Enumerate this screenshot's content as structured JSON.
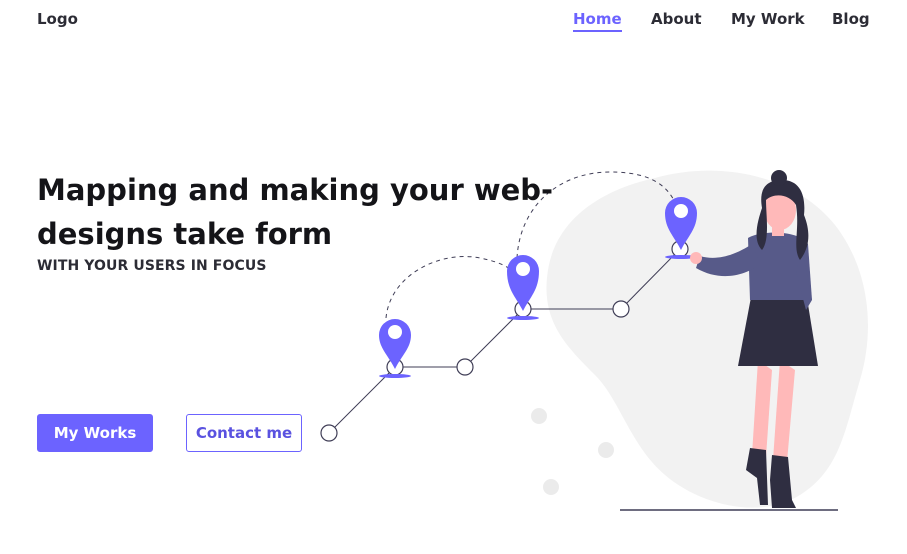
{
  "header": {
    "logo": "Logo",
    "nav": [
      {
        "label": "Home",
        "active": true
      },
      {
        "label": "About",
        "active": false
      },
      {
        "label": "My Work",
        "active": false
      },
      {
        "label": "Blog",
        "active": false
      }
    ]
  },
  "hero": {
    "title": "Mapping and making your web-designs take form",
    "subtitle": "WITH YOUR USERS IN FOCUS",
    "primary_button": "My Works",
    "secondary_button": "Contact me"
  },
  "colors": {
    "accent": "#6c63ff",
    "text_dark": "#2c2c35",
    "blob": "#f2f2f2",
    "shirt": "#575a89",
    "skirt": "#2f2e41",
    "skin": "#ffb9b9"
  },
  "illustration": {
    "name": "woman-placing-map-pins-illustration"
  }
}
